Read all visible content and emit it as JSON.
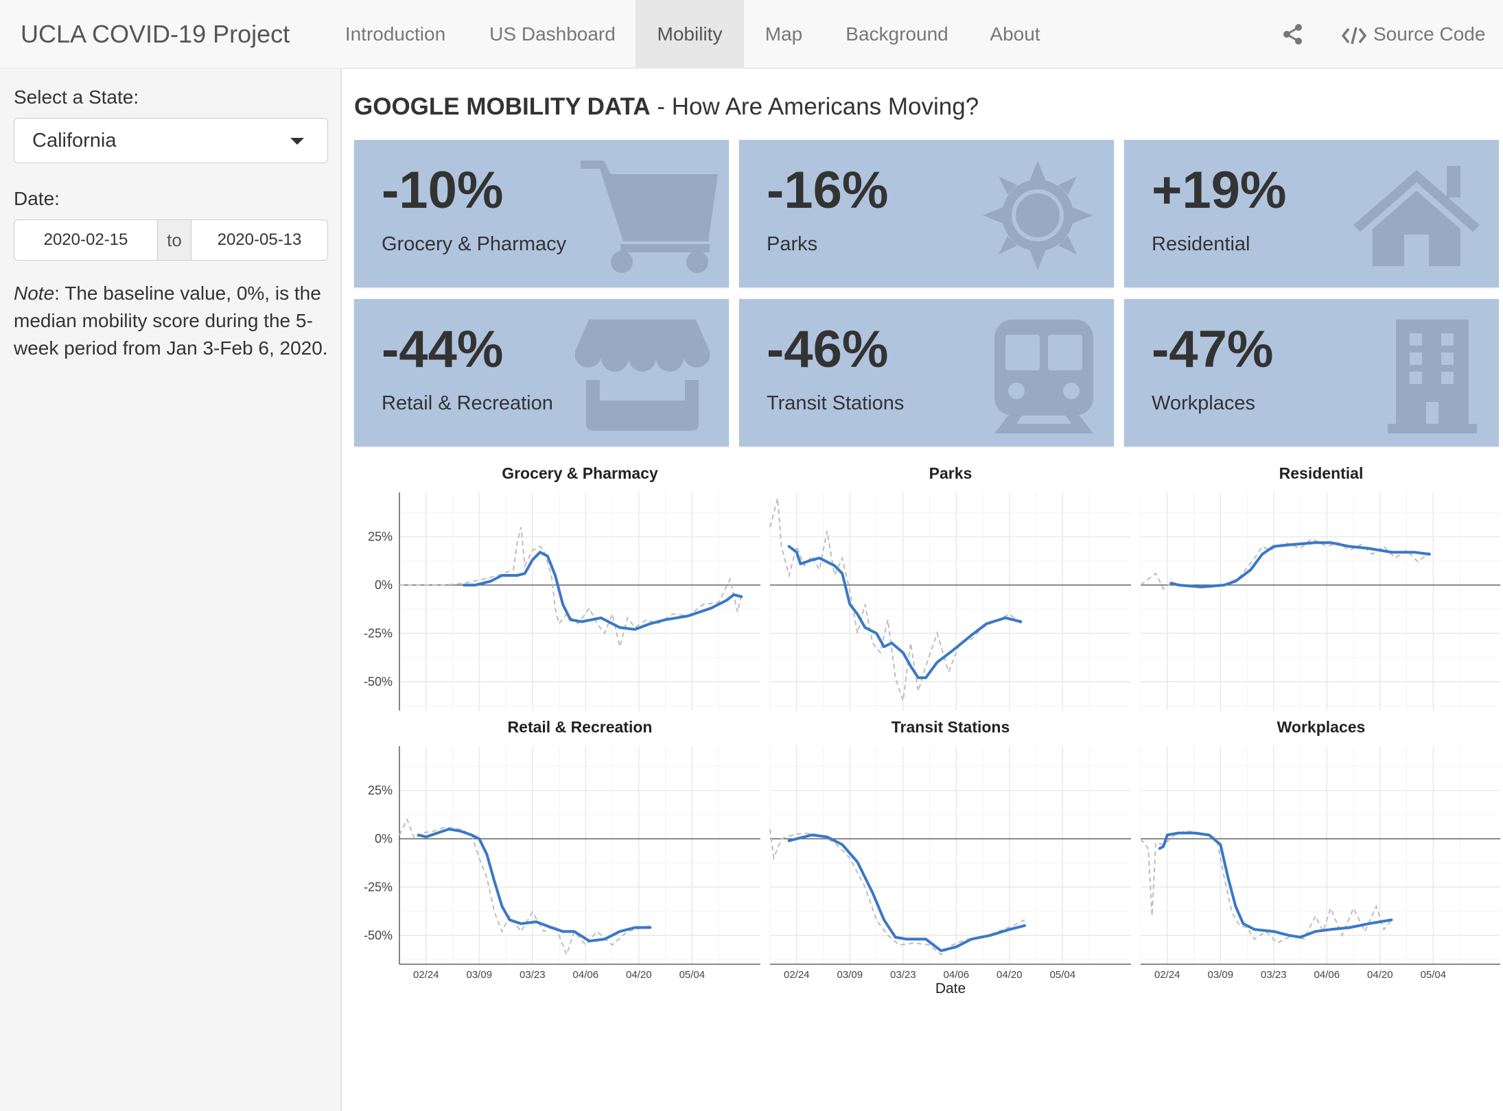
{
  "navbar": {
    "brand": "UCLA COVID-19 Project",
    "items": [
      "Introduction",
      "US Dashboard",
      "Mobility",
      "Map",
      "Background",
      "About"
    ],
    "active": "Mobility",
    "source_label": "Source Code"
  },
  "sidebar": {
    "state_label": "Select a State:",
    "state_value": "California",
    "date_label": "Date:",
    "date_start": "2020-02-15",
    "date_sep": "to",
    "date_end": "2020-05-13",
    "note_prefix": "Note",
    "note_text": ": The baseline value, 0%, is the median mobility score during the 5-week period from Jan 3-Feb 6, 2020."
  },
  "main": {
    "title_bold": "GOOGLE MOBILITY DATA",
    "title_rest": " - How Are Americans Moving?",
    "cards": [
      {
        "pct": "-10%",
        "name": "Grocery & Pharmacy",
        "icon": "cart-icon"
      },
      {
        "pct": "-16%",
        "name": "Parks",
        "icon": "sun-icon"
      },
      {
        "pct": "+19%",
        "name": "Residential",
        "icon": "home-icon"
      },
      {
        "pct": "-44%",
        "name": "Retail & Recreation",
        "icon": "store-icon"
      },
      {
        "pct": "-46%",
        "name": "Transit Stations",
        "icon": "train-icon"
      },
      {
        "pct": "-47%",
        "name": "Workplaces",
        "icon": "building-icon"
      }
    ],
    "card_color": "#b0c4de",
    "icon_color": "#97aac2"
  },
  "chart_data": {
    "type": "line",
    "layout": "small multiples, 3 columns x 2 rows",
    "xlabel": "Date",
    "x_ticks": [
      "02/24",
      "03/09",
      "03/23",
      "04/06",
      "04/20",
      "05/04"
    ],
    "y_ticks": [
      "25%",
      "0%",
      "-25%",
      "-50%"
    ],
    "ylim": [
      -65,
      48
    ],
    "line_color": "#3a78c7",
    "raw_line_style": "dashed grey",
    "panels": [
      {
        "title": "Grocery & Pharmacy",
        "smoothed": [
          [
            17,
            0
          ],
          [
            20,
            0
          ],
          [
            24,
            2
          ],
          [
            27,
            5
          ],
          [
            31,
            5
          ],
          [
            33,
            6
          ],
          [
            35,
            13
          ],
          [
            37,
            17
          ],
          [
            39,
            15
          ],
          [
            41,
            5
          ],
          [
            43,
            -10
          ],
          [
            45,
            -18
          ],
          [
            48,
            -19
          ],
          [
            53,
            -17
          ],
          [
            58,
            -22
          ],
          [
            62,
            -23
          ],
          [
            66,
            -20
          ],
          [
            70,
            -18
          ],
          [
            76,
            -16
          ],
          [
            82,
            -12
          ],
          [
            86,
            -8
          ],
          [
            88,
            -5
          ],
          [
            90,
            -6
          ]
        ],
        "raw": [
          [
            0,
            0
          ],
          [
            6,
            0
          ],
          [
            12,
            0
          ],
          [
            17,
            1
          ],
          [
            22,
            3
          ],
          [
            26,
            5
          ],
          [
            30,
            8
          ],
          [
            31,
            22
          ],
          [
            32,
            30
          ],
          [
            33,
            10
          ],
          [
            35,
            18
          ],
          [
            37,
            20
          ],
          [
            38,
            18
          ],
          [
            40,
            5
          ],
          [
            41,
            -12
          ],
          [
            42,
            -20
          ],
          [
            44,
            -15
          ],
          [
            47,
            -20
          ],
          [
            50,
            -12
          ],
          [
            52,
            -20
          ],
          [
            54,
            -25
          ],
          [
            56,
            -15
          ],
          [
            58,
            -32
          ],
          [
            60,
            -17
          ],
          [
            62,
            -22
          ],
          [
            65,
            -18
          ],
          [
            68,
            -20
          ],
          [
            72,
            -15
          ],
          [
            76,
            -16
          ],
          [
            80,
            -10
          ],
          [
            84,
            -9
          ],
          [
            87,
            3
          ],
          [
            89,
            -14
          ],
          [
            90,
            -5
          ]
        ]
      },
      {
        "title": "Parks",
        "smoothed": [
          [
            5,
            20
          ],
          [
            7,
            17
          ],
          [
            8,
            11
          ],
          [
            11,
            13
          ],
          [
            13,
            14
          ],
          [
            15,
            12
          ],
          [
            17,
            10
          ],
          [
            19,
            6
          ],
          [
            21,
            -10
          ],
          [
            23,
            -15
          ],
          [
            25,
            -22
          ],
          [
            28,
            -25
          ],
          [
            30,
            -32
          ],
          [
            32,
            -30
          ],
          [
            35,
            -35
          ],
          [
            37,
            -42
          ],
          [
            39,
            -48
          ],
          [
            41,
            -48
          ],
          [
            44,
            -40
          ],
          [
            48,
            -34
          ],
          [
            53,
            -26
          ],
          [
            57,
            -20
          ],
          [
            62,
            -17
          ],
          [
            66,
            -19
          ]
        ],
        "raw": [
          [
            0,
            30
          ],
          [
            2,
            45
          ],
          [
            3,
            20
          ],
          [
            5,
            5
          ],
          [
            7,
            20
          ],
          [
            9,
            10
          ],
          [
            11,
            15
          ],
          [
            13,
            8
          ],
          [
            15,
            28
          ],
          [
            17,
            5
          ],
          [
            19,
            14
          ],
          [
            21,
            -3
          ],
          [
            23,
            -25
          ],
          [
            25,
            -10
          ],
          [
            27,
            -30
          ],
          [
            29,
            -35
          ],
          [
            31,
            -18
          ],
          [
            33,
            -48
          ],
          [
            35,
            -60
          ],
          [
            37,
            -30
          ],
          [
            39,
            -55
          ],
          [
            41,
            -42
          ],
          [
            44,
            -25
          ],
          [
            47,
            -45
          ],
          [
            50,
            -30
          ],
          [
            53,
            -28
          ],
          [
            56,
            -22
          ],
          [
            60,
            -18
          ],
          [
            63,
            -15
          ],
          [
            66,
            -20
          ]
        ]
      },
      {
        "title": "Residential",
        "smoothed": [
          [
            8,
            1
          ],
          [
            10,
            0
          ],
          [
            16,
            -1
          ],
          [
            22,
            0
          ],
          [
            25,
            2
          ],
          [
            29,
            8
          ],
          [
            32,
            16
          ],
          [
            35,
            20
          ],
          [
            40,
            21
          ],
          [
            46,
            22
          ],
          [
            50,
            22
          ],
          [
            55,
            20
          ],
          [
            60,
            19
          ],
          [
            66,
            17
          ],
          [
            72,
            17
          ],
          [
            76,
            16
          ]
        ],
        "raw": [
          [
            0,
            0
          ],
          [
            4,
            6
          ],
          [
            6,
            -2
          ],
          [
            8,
            1
          ],
          [
            14,
            -1
          ],
          [
            22,
            0
          ],
          [
            26,
            4
          ],
          [
            30,
            14
          ],
          [
            32,
            20
          ],
          [
            34,
            18
          ],
          [
            38,
            22
          ],
          [
            42,
            19
          ],
          [
            45,
            24
          ],
          [
            49,
            20
          ],
          [
            52,
            22
          ],
          [
            55,
            18
          ],
          [
            58,
            21
          ],
          [
            61,
            16
          ],
          [
            64,
            20
          ],
          [
            67,
            14
          ],
          [
            70,
            18
          ],
          [
            73,
            12
          ],
          [
            76,
            17
          ]
        ]
      },
      {
        "title": "Retail & Recreation",
        "smoothed": [
          [
            5,
            2
          ],
          [
            7,
            1
          ],
          [
            10,
            3
          ],
          [
            13,
            5
          ],
          [
            16,
            4
          ],
          [
            19,
            2
          ],
          [
            21,
            0
          ],
          [
            23,
            -8
          ],
          [
            25,
            -22
          ],
          [
            27,
            -35
          ],
          [
            29,
            -42
          ],
          [
            32,
            -44
          ],
          [
            36,
            -43
          ],
          [
            40,
            -46
          ],
          [
            43,
            -48
          ],
          [
            46,
            -48
          ],
          [
            50,
            -53
          ],
          [
            54,
            -52
          ],
          [
            58,
            -48
          ],
          [
            62,
            -46
          ],
          [
            66,
            -46
          ]
        ],
        "raw": [
          [
            0,
            2
          ],
          [
            2,
            10
          ],
          [
            4,
            0
          ],
          [
            6,
            3
          ],
          [
            9,
            4
          ],
          [
            12,
            6
          ],
          [
            16,
            5
          ],
          [
            19,
            2
          ],
          [
            21,
            -10
          ],
          [
            23,
            -20
          ],
          [
            25,
            -38
          ],
          [
            27,
            -48
          ],
          [
            29,
            -40
          ],
          [
            32,
            -48
          ],
          [
            35,
            -38
          ],
          [
            38,
            -48
          ],
          [
            41,
            -45
          ],
          [
            44,
            -60
          ],
          [
            46,
            -48
          ],
          [
            49,
            -55
          ],
          [
            52,
            -48
          ],
          [
            56,
            -55
          ],
          [
            60,
            -48
          ],
          [
            66,
            -45
          ]
        ]
      },
      {
        "title": "Transit Stations",
        "smoothed": [
          [
            5,
            -1
          ],
          [
            7,
            0
          ],
          [
            11,
            2
          ],
          [
            15,
            1
          ],
          [
            19,
            -3
          ],
          [
            23,
            -12
          ],
          [
            27,
            -28
          ],
          [
            30,
            -42
          ],
          [
            33,
            -51
          ],
          [
            36,
            -52
          ],
          [
            41,
            -52
          ],
          [
            45,
            -58
          ],
          [
            49,
            -56
          ],
          [
            53,
            -52
          ],
          [
            58,
            -50
          ],
          [
            63,
            -47
          ],
          [
            67,
            -45
          ]
        ],
        "raw": [
          [
            0,
            5
          ],
          [
            1,
            -10
          ],
          [
            3,
            0
          ],
          [
            6,
            2
          ],
          [
            9,
            3
          ],
          [
            13,
            2
          ],
          [
            17,
            -2
          ],
          [
            21,
            -10
          ],
          [
            25,
            -25
          ],
          [
            28,
            -42
          ],
          [
            31,
            -50
          ],
          [
            34,
            -55
          ],
          [
            38,
            -54
          ],
          [
            42,
            -55
          ],
          [
            45,
            -60
          ],
          [
            48,
            -55
          ],
          [
            52,
            -52
          ],
          [
            56,
            -51
          ],
          [
            60,
            -48
          ],
          [
            64,
            -45
          ],
          [
            67,
            -42
          ]
        ]
      },
      {
        "title": "Workplaces",
        "smoothed": [
          [
            5,
            -5
          ],
          [
            6,
            -4
          ],
          [
            7,
            2
          ],
          [
            10,
            3
          ],
          [
            14,
            3
          ],
          [
            18,
            2
          ],
          [
            21,
            -3
          ],
          [
            23,
            -20
          ],
          [
            25,
            -35
          ],
          [
            27,
            -44
          ],
          [
            30,
            -47
          ],
          [
            35,
            -48
          ],
          [
            39,
            -50
          ],
          [
            42,
            -51
          ],
          [
            46,
            -48
          ],
          [
            50,
            -47
          ],
          [
            55,
            -46
          ],
          [
            60,
            -44
          ],
          [
            66,
            -42
          ]
        ],
        "raw": [
          [
            0,
            0
          ],
          [
            2,
            -5
          ],
          [
            3,
            -40
          ],
          [
            4,
            -2
          ],
          [
            6,
            -3
          ],
          [
            9,
            2
          ],
          [
            12,
            4
          ],
          [
            16,
            3
          ],
          [
            20,
            0
          ],
          [
            22,
            -20
          ],
          [
            24,
            -38
          ],
          [
            26,
            -45
          ],
          [
            28,
            -46
          ],
          [
            30,
            -52
          ],
          [
            33,
            -48
          ],
          [
            36,
            -54
          ],
          [
            40,
            -50
          ],
          [
            43,
            -52
          ],
          [
            46,
            -40
          ],
          [
            48,
            -48
          ],
          [
            50,
            -36
          ],
          [
            53,
            -50
          ],
          [
            56,
            -36
          ],
          [
            59,
            -48
          ],
          [
            62,
            -35
          ],
          [
            64,
            -47
          ],
          [
            66,
            -42
          ]
        ]
      }
    ]
  }
}
